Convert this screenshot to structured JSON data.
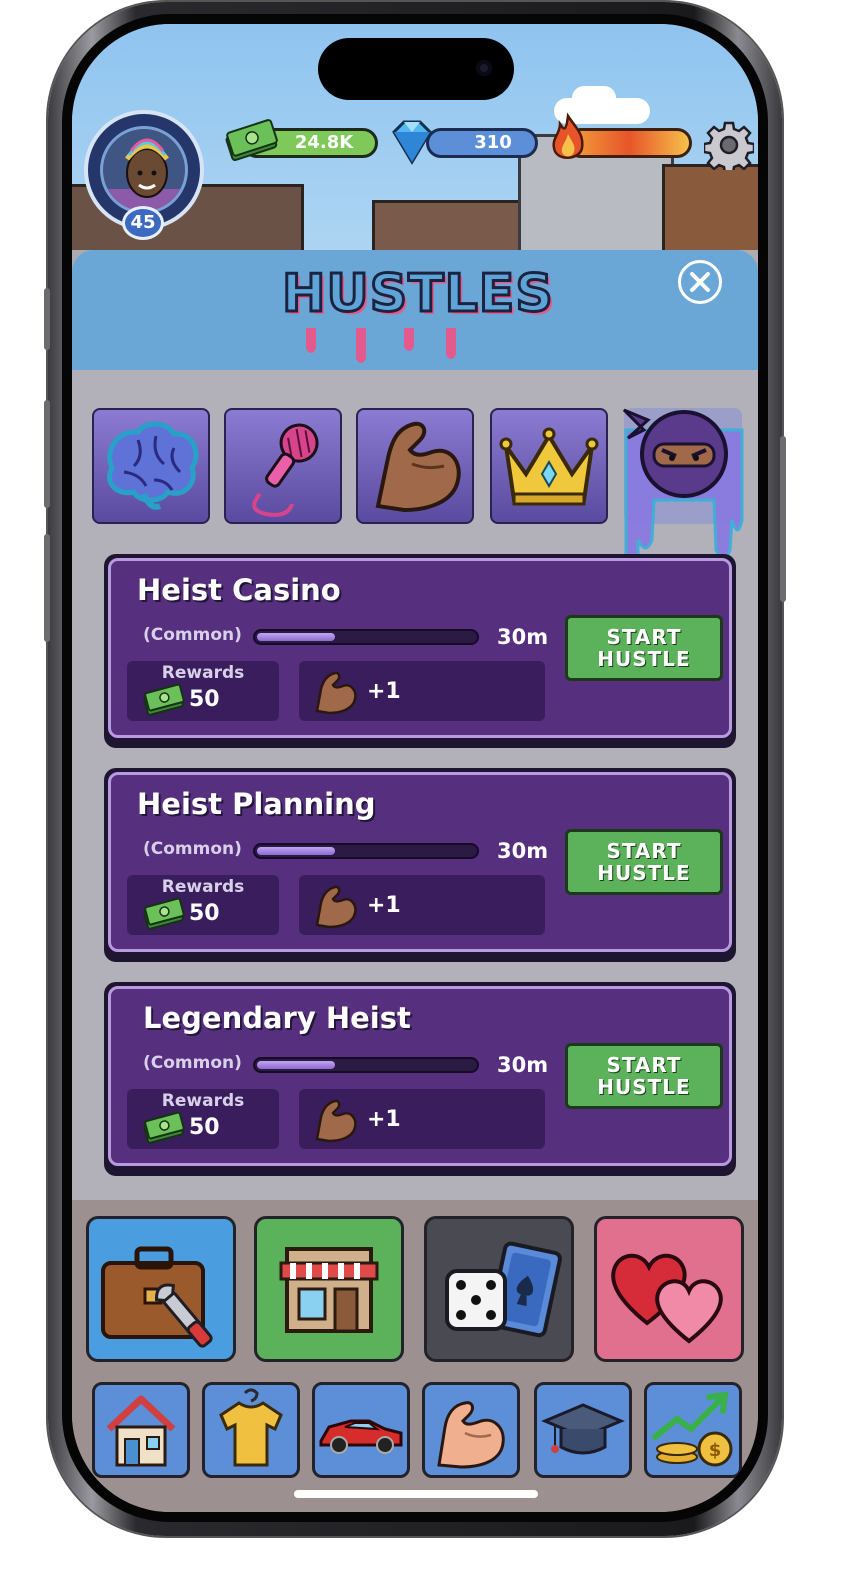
{
  "hud": {
    "level": "45",
    "cash": "24.8K",
    "gems": "310"
  },
  "panel": {
    "title": "HUSTLES"
  },
  "categories": [
    "brain",
    "microphone",
    "muscle",
    "crown",
    "ninja"
  ],
  "hustles": [
    {
      "title": "Heist Casino",
      "rarity": "(Common)",
      "time": "30m",
      "progress": 0.35,
      "rewards_label": "Rewards",
      "reward_cash": "50",
      "stat_gain": "+1",
      "button": "START\nHUSTLE"
    },
    {
      "title": "Heist Planning",
      "rarity": "(Common)",
      "time": "30m",
      "progress": 0.35,
      "rewards_label": "Rewards",
      "reward_cash": "50",
      "stat_gain": "+1",
      "button": "START\nHUSTLE"
    },
    {
      "title": "Legendary Heist",
      "rarity": "(Common)",
      "time": "30m",
      "progress": 0.35,
      "rewards_label": "Rewards",
      "reward_cash": "50",
      "stat_gain": "+1",
      "button": "START\nHUSTLE"
    }
  ],
  "dock": {
    "big": [
      "jobs-briefcase",
      "shop-store",
      "gamble-dice",
      "dating-hearts"
    ],
    "small": [
      "home",
      "clothing",
      "cars",
      "gym",
      "education",
      "investments"
    ]
  },
  "colors": {
    "accent": "#56307f",
    "start_button": "#5bb25a",
    "dock_tile": "#5c8fd8"
  }
}
